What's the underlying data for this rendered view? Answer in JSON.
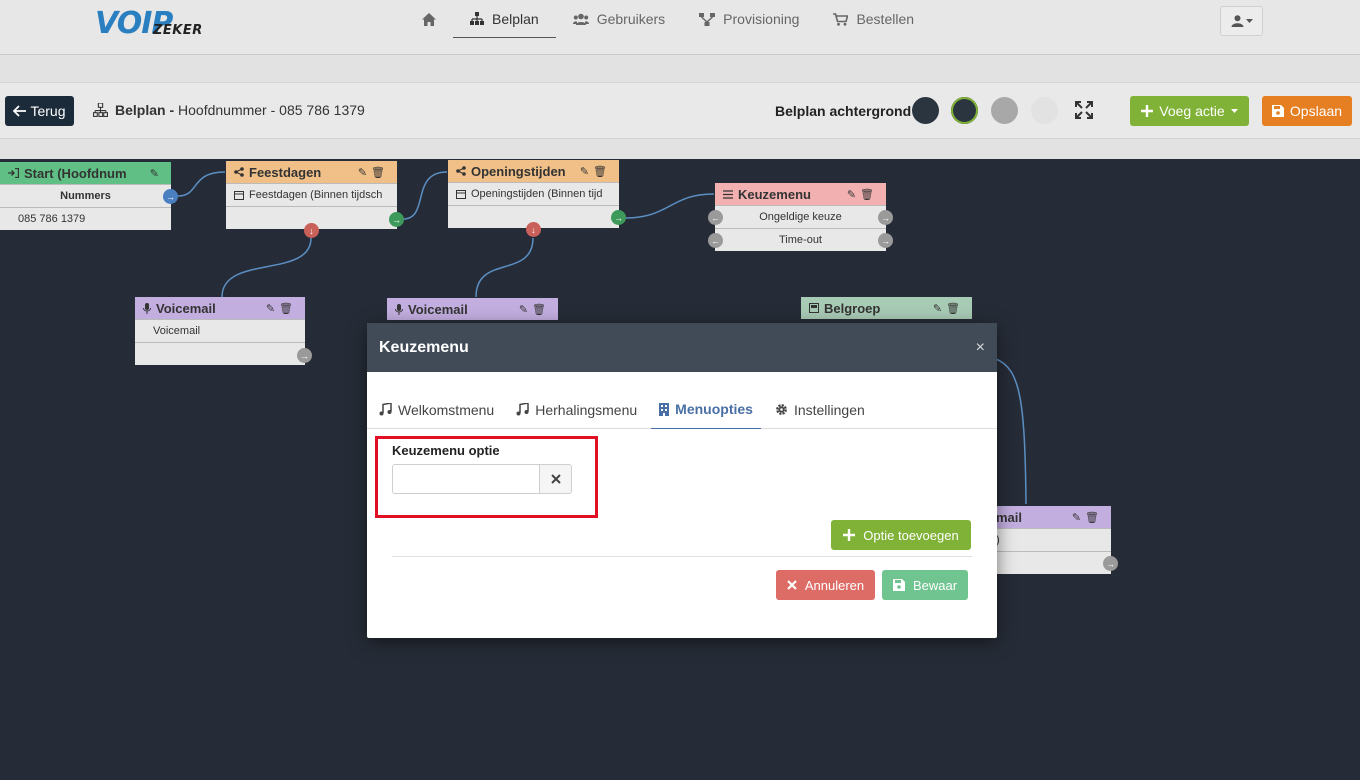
{
  "logo": {
    "part1": "VOIP",
    "part2": "ZEKER"
  },
  "nav": {
    "home_icon": "home-icon",
    "items": [
      {
        "label": "Belplan",
        "icon": "sitemap-icon"
      },
      {
        "label": "Gebruikers",
        "icon": "users-icon"
      },
      {
        "label": "Provisioning",
        "icon": "network-icon"
      },
      {
        "label": "Bestellen",
        "icon": "cart-icon"
      }
    ],
    "active": "Belplan",
    "user_icon": "user-icon"
  },
  "toolbar": {
    "back_label": "Terug",
    "crumb_bold": "Belplan -",
    "crumb_rest": "Hoofdnummer - 085 786 1379",
    "bg_label": "Belplan achtergrond",
    "swatches": [
      "#2b3540",
      "#2b3540",
      "#a8a8a8",
      "#e4e4e4"
    ],
    "selected_swatch": 1,
    "accent_selected": "#7fb236",
    "add_action_label": "Voeg actie",
    "save_label": "Opslaan"
  },
  "nodes": {
    "start": {
      "title": "Start (Hoofdnum",
      "row1": "Nummers",
      "row2": "085 786 1379",
      "color": "#5fbf85"
    },
    "feestdagen": {
      "title": "Feestdagen",
      "row1": "Feestdagen (Binnen tijdsch",
      "color": "#f0c088"
    },
    "openingstijden": {
      "title": "Openingstijden",
      "row1": "Openingstijden (Binnen tijd",
      "color": "#f0c088"
    },
    "keuzemenu": {
      "title": "Keuzemenu",
      "row1": "Ongeldige keuze",
      "row2": "Time-out",
      "color": "#f2b0b0"
    },
    "voicemail1": {
      "title": "Voicemail",
      "row1": "Voicemail",
      "color": "#c3aee0"
    },
    "voicemail2": {
      "title": "Voicemail",
      "color": "#c3aee0"
    },
    "belgroep": {
      "title": "Belgroep",
      "color": "#a8cbb5"
    },
    "voicemail3": {
      "title_partial": "mail",
      "row1_partial": ")",
      "color": "#c3aee0"
    }
  },
  "modal": {
    "title": "Keuzemenu",
    "close": "×",
    "tabs": [
      {
        "label": "Welkomstmenu",
        "icon": "music-icon"
      },
      {
        "label": "Herhalingsmenu",
        "icon": "music-icon"
      },
      {
        "label": "Menuopties",
        "icon": "building-icon"
      },
      {
        "label": "Instellingen",
        "icon": "gear-icon"
      }
    ],
    "active_tab": "Menuopties",
    "option_label": "Keuzemenu optie",
    "option_value": "",
    "add_option_label": "Optie toevoegen",
    "cancel_label": "Annuleren",
    "save_label": "Bewaar"
  }
}
